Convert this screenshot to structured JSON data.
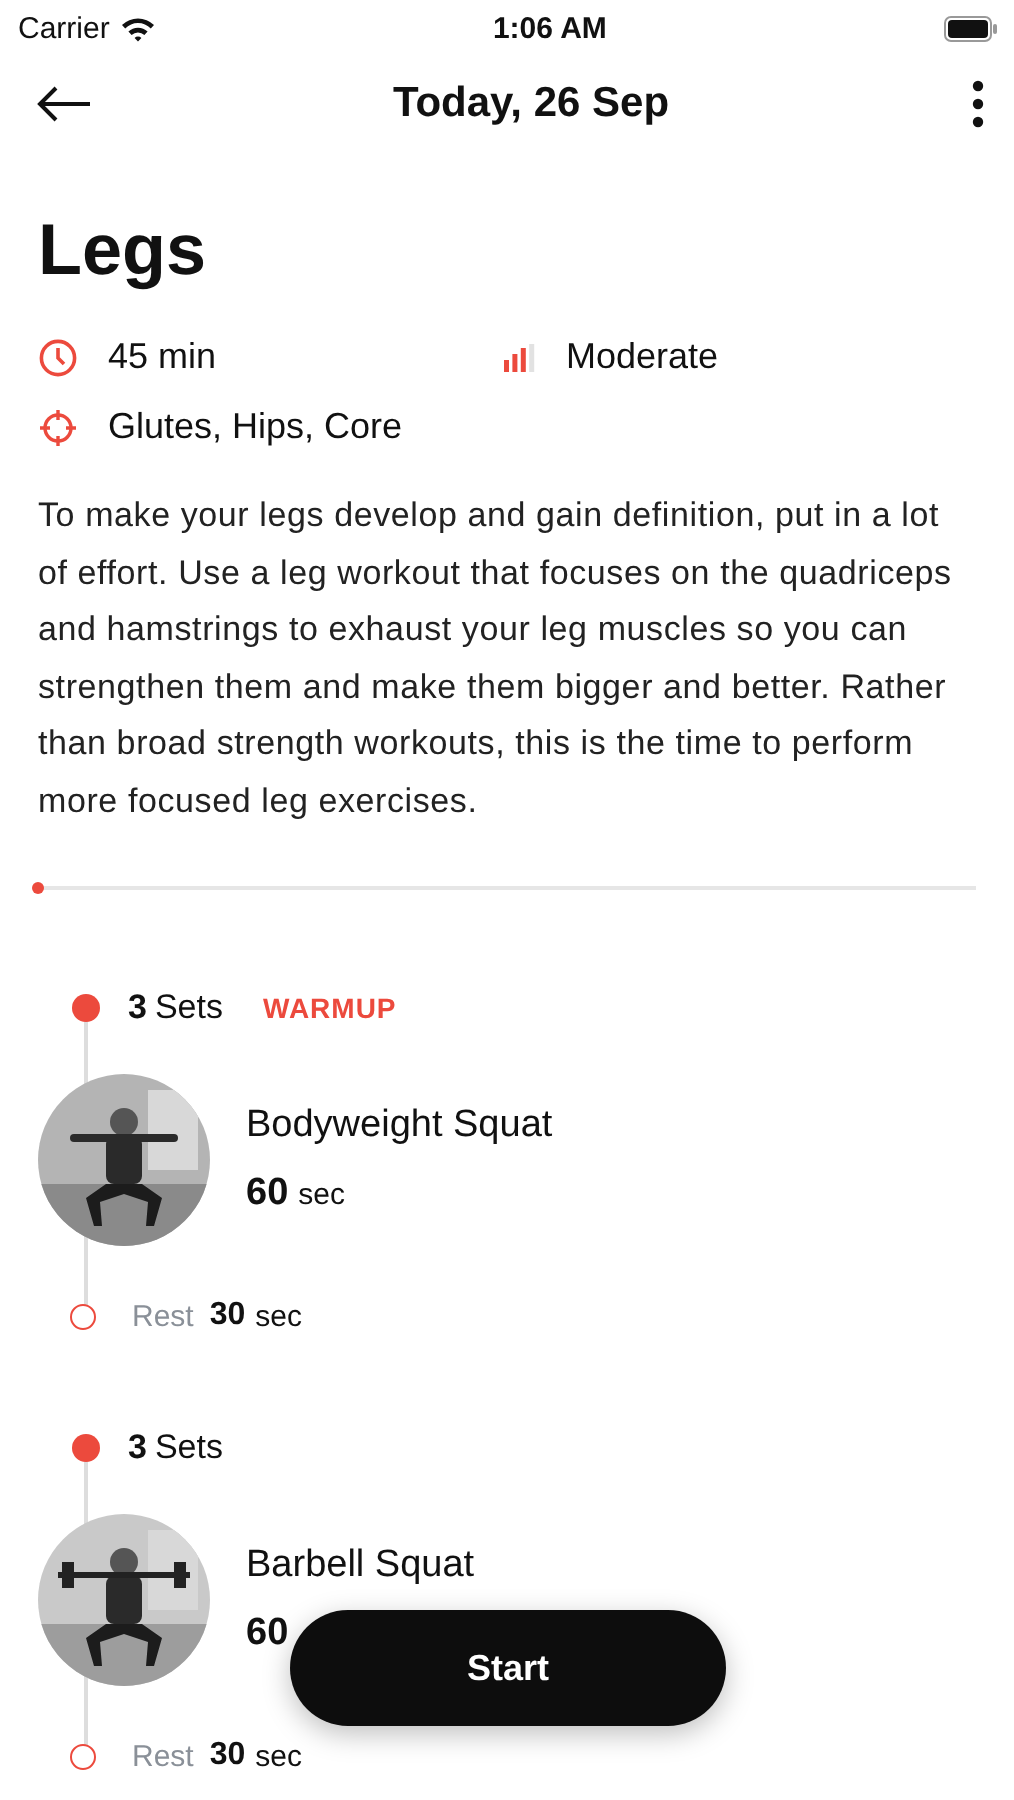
{
  "status_bar": {
    "carrier": "Carrier",
    "time": "1:06 AM"
  },
  "header": {
    "title": "Today, 26 Sep"
  },
  "workout": {
    "title": "Legs",
    "duration": "45 min",
    "difficulty": "Moderate",
    "muscles": "Glutes, Hips, Core",
    "description": "To make your legs develop and gain definition, put in a lot of effort. Use a leg workout that focuses on the quadriceps and hamstrings to exhaust your leg muscles so you can strengthen them and make them bigger and better. Rather than broad strength workouts, this is the time to perform more focused leg exercises."
  },
  "progress": {
    "level": 0
  },
  "exercises": [
    {
      "sets_count": "3",
      "sets_label": "Sets",
      "tag": "WARMUP",
      "name": "Bodyweight Squat",
      "duration_value": "60",
      "duration_unit": "sec",
      "rest_label": "Rest",
      "rest_value": "30",
      "rest_unit": "sec"
    },
    {
      "sets_count": "3",
      "sets_label": "Sets",
      "name": "Barbell Squat",
      "duration_value": "60",
      "rest_label": "Rest",
      "rest_value": "30",
      "rest_unit": "sec"
    }
  ],
  "start_button": "Start"
}
